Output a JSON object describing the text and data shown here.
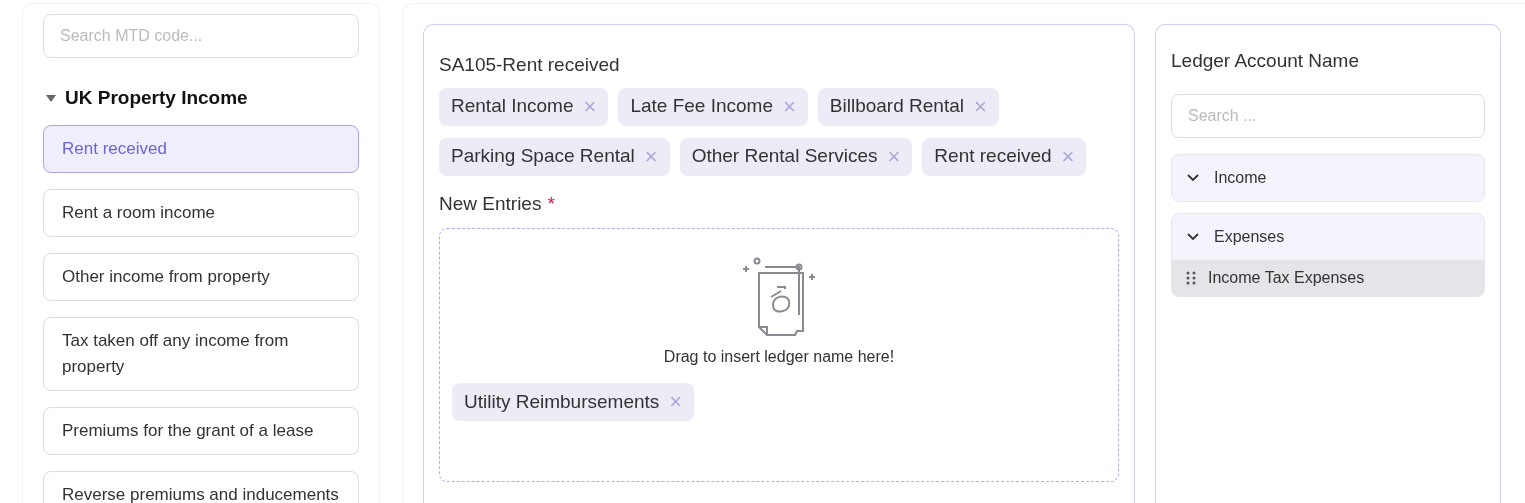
{
  "sidebar": {
    "search": {
      "placeholder": "Search MTD code..."
    },
    "section": {
      "title": "UK Property Income",
      "expanded": true
    },
    "items": [
      {
        "label": "Rent received",
        "selected": true
      },
      {
        "label": "Rent a room income",
        "selected": false
      },
      {
        "label": "Other income from property",
        "selected": false
      },
      {
        "label": "Tax taken off any income from property",
        "selected": false
      },
      {
        "label": "Premiums for the grant of a lease",
        "selected": false
      },
      {
        "label": "Reverse premiums and inducements",
        "selected": false
      }
    ]
  },
  "mapping": {
    "title": "SA105-Rent received",
    "tags": [
      {
        "label": "Rental Income",
        "remove": "×"
      },
      {
        "label": "Late Fee Income",
        "remove": "×"
      },
      {
        "label": "Billboard Rental",
        "remove": "×"
      },
      {
        "label": "Parking Space Rental",
        "remove": "×"
      },
      {
        "label": "Other Rental Services",
        "remove": "×"
      },
      {
        "label": "Rent received",
        "remove": "×"
      }
    ],
    "new_entries": {
      "label": "New Entries",
      "required_mark": "*",
      "hint": "Drag to insert ledger name here!",
      "tags": [
        {
          "label": "Utility Reimbursements",
          "remove": "×"
        }
      ]
    }
  },
  "ledger": {
    "title": "Ledger Account Name",
    "search": {
      "placeholder": "Search ..."
    },
    "groups": [
      {
        "label": "Income",
        "expanded": true
      },
      {
        "label": "Expenses",
        "expanded": true,
        "children": [
          {
            "label": "Income Tax Expenses"
          }
        ]
      }
    ]
  }
}
